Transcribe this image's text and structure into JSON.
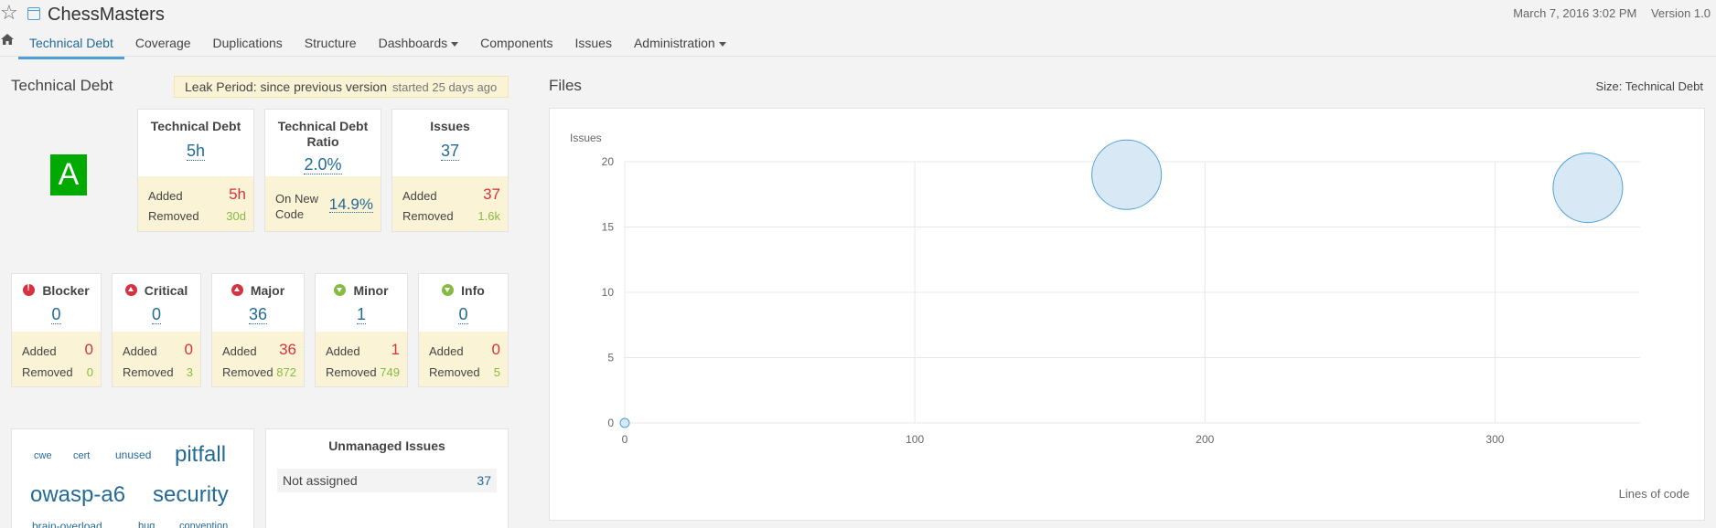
{
  "header": {
    "project_name": "ChessMasters",
    "date": "March 7, 2016 3:02 PM",
    "version": "Version 1.0"
  },
  "nav": {
    "items": [
      {
        "label": "Technical Debt",
        "active": true
      },
      {
        "label": "Coverage"
      },
      {
        "label": "Duplications"
      },
      {
        "label": "Structure"
      },
      {
        "label": "Dashboards",
        "dropdown": true
      },
      {
        "label": "Components"
      },
      {
        "label": "Issues"
      },
      {
        "label": "Administration",
        "dropdown": true
      }
    ]
  },
  "debt": {
    "title": "Technical Debt",
    "leak_period": "Leak Period: since previous version",
    "leak_started": "started 25 days ago",
    "rating": "A",
    "cards": {
      "debt": {
        "title": "Technical Debt",
        "value": "5h",
        "added_label": "Added",
        "added": "5h",
        "removed_label": "Removed",
        "removed": "30d"
      },
      "ratio": {
        "title_line1": "Technical Debt",
        "title_line2": "Ratio",
        "value": "2.0%",
        "new_label_1": "On New",
        "new_label_2": "Code",
        "new_value": "14.9%"
      },
      "issues": {
        "title": "Issues",
        "value": "37",
        "added_label": "Added",
        "added": "37",
        "removed_label": "Removed",
        "removed": "1.6k"
      }
    },
    "severities": [
      {
        "name": "Blocker",
        "value": "0",
        "added_label": "Added",
        "added": "0",
        "removed_label": "Removed",
        "removed": "0"
      },
      {
        "name": "Critical",
        "value": "0",
        "added_label": "Added",
        "added": "0",
        "removed_label": "Removed",
        "removed": "3"
      },
      {
        "name": "Major",
        "value": "36",
        "added_label": "Added",
        "added": "36",
        "removed_label": "Removed",
        "removed": "872"
      },
      {
        "name": "Minor",
        "value": "1",
        "added_label": "Added",
        "added": "1",
        "removed_label": "Removed",
        "removed": "749"
      },
      {
        "name": "Info",
        "value": "0",
        "added_label": "Added",
        "added": "0",
        "removed_label": "Removed",
        "removed": "5"
      }
    ],
    "tags": [
      "cwe",
      "cert",
      "unused",
      "pitfall",
      "owasp-a6",
      "security",
      "brain-overload",
      "bug",
      "convention"
    ],
    "unmanaged": {
      "title": "Unmanaged Issues",
      "row_label": "Not assigned",
      "row_value": "37"
    }
  },
  "files": {
    "title": "Files",
    "size_label": "Size: Technical Debt"
  },
  "chart_data": {
    "type": "scatter",
    "title": "",
    "xlabel": "Lines of code",
    "ylabel": "Issues",
    "xlim": [
      0,
      350
    ],
    "ylim": [
      0,
      20
    ],
    "x_ticks": [
      0,
      100,
      200,
      300
    ],
    "y_ticks": [
      0,
      5,
      10,
      15,
      20
    ],
    "grid": true,
    "points": [
      {
        "x": 0,
        "y": 0,
        "size": "tiny"
      },
      {
        "x": 173,
        "y": 19,
        "size": "large"
      },
      {
        "x": 332,
        "y": 18,
        "size": "large"
      }
    ],
    "colors": {
      "fill": "#d9e8f5",
      "stroke": "#4b9fd5"
    }
  }
}
